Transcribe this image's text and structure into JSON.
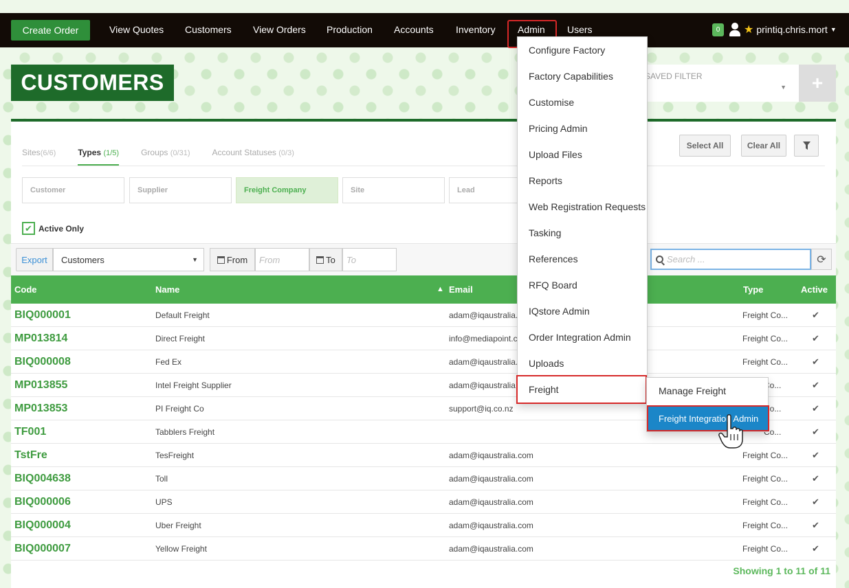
{
  "navbar": {
    "create_order": "Create Order",
    "items": [
      "View Quotes",
      "Customers",
      "View Orders",
      "Production",
      "Accounts",
      "Inventory",
      "Admin",
      "Users"
    ],
    "badge": "0",
    "username": "printiq.chris.mort"
  },
  "page": {
    "title": "CUSTOMERS",
    "saved_filter": "SAVED FILTER",
    "add": "+"
  },
  "filters": {
    "tabs": [
      {
        "label": "Sites",
        "count": "(6/6)"
      },
      {
        "label": "Types",
        "count": "(1/5)"
      },
      {
        "label": "Groups",
        "count": "(0/31)"
      },
      {
        "label": "Account Statuses",
        "count": "(0/3)"
      }
    ],
    "select_all": "Select All",
    "clear_all": "Clear All",
    "chips": [
      "Customer",
      "Supplier",
      "Freight Company",
      "Site",
      "Lead"
    ],
    "active_only": "Active Only"
  },
  "toolbar": {
    "export": "Export",
    "export_value": "Customers",
    "from_label": "From",
    "from_placeholder": "From",
    "to_label": "To",
    "to_placeholder": "To",
    "search_placeholder": "Search ..."
  },
  "table": {
    "headers": {
      "code": "Code",
      "name": "Name",
      "email": "Email",
      "type": "Type",
      "active": "Active"
    },
    "rows": [
      {
        "code": "BIQ000001",
        "name": "Default Freight",
        "email": "adam@iqaustralia.",
        "type": "Freight Co..."
      },
      {
        "code": "MP013814",
        "name": "Direct Freight",
        "email": "info@mediapoint.c",
        "type": "Freight Co..."
      },
      {
        "code": "BIQ000008",
        "name": "Fed Ex",
        "email": "adam@iqaustralia.",
        "type": "Freight Co..."
      },
      {
        "code": "MP013855",
        "name": "Intel Freight Supplier",
        "email": "adam@iqaustralia",
        "type": "Co..."
      },
      {
        "code": "MP013853",
        "name": "PI Freight Co",
        "email": "support@iq.co.nz",
        "type": "Co..."
      },
      {
        "code": "TF001",
        "name": "Tabblers Freight",
        "email": "",
        "type": "Co..."
      },
      {
        "code": "TstFre",
        "name": "TesFreight",
        "email": "adam@iqaustralia.com",
        "type": "Freight Co..."
      },
      {
        "code": "BIQ004638",
        "name": "Toll",
        "email": "adam@iqaustralia.com",
        "type": "Freight Co..."
      },
      {
        "code": "BIQ000006",
        "name": "UPS",
        "email": "adam@iqaustralia.com",
        "type": "Freight Co..."
      },
      {
        "code": "BIQ000004",
        "name": "Uber Freight",
        "email": "adam@iqaustralia.com",
        "type": "Freight Co..."
      },
      {
        "code": "BIQ000007",
        "name": "Yellow Freight",
        "email": "adam@iqaustralia.com",
        "type": "Freight Co..."
      }
    ],
    "showing": "Showing 1 to 11 of 11"
  },
  "admin_menu": {
    "items": [
      "Configure Factory",
      "Factory Capabilities",
      "Customise",
      "Pricing Admin",
      "Upload Files",
      "Reports",
      "Web Registration Requests",
      "Tasking",
      "References",
      "RFQ Board",
      "IQstore Admin",
      "Order Integration Admin",
      "Uploads",
      "Freight"
    ],
    "freight_submenu": [
      "Manage Freight",
      "Freight Integration Admin"
    ]
  },
  "icons": {
    "check": "check-icon",
    "user": "user-icon",
    "star": "star-icon",
    "calendar": "calendar-icon",
    "search": "search-icon",
    "refresh": "refresh-icon",
    "filter": "funnel-icon",
    "cursor": "hand-pointer-icon"
  },
  "colors": {
    "brand_dark_green": "#1e6b2a",
    "table_header_green": "#4caf50",
    "code_green": "#3e9b3f",
    "highlight_blue": "#1b86c8",
    "annotation_red": "#d62828"
  }
}
